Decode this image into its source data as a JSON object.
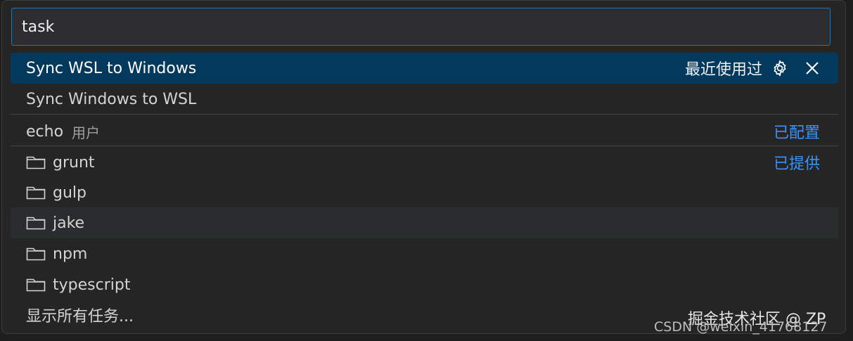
{
  "search": {
    "value": "task"
  },
  "items": [
    {
      "label": "Sync WSL to Windows",
      "recent_label": "最近使用过"
    },
    {
      "label": "Sync Windows to WSL"
    },
    {
      "label": "echo",
      "desc": "用户",
      "tag": "已配置"
    }
  ],
  "folders": [
    {
      "label": "grunt",
      "tag": "已提供"
    },
    {
      "label": "gulp"
    },
    {
      "label": "jake"
    },
    {
      "label": "npm"
    },
    {
      "label": "typescript"
    }
  ],
  "show_all": {
    "label": "显示所有任务..."
  },
  "watermark": {
    "line1": "掘金技术社区 @ ZP",
    "line2": "CSDN @weixin_41768127"
  },
  "colors": {
    "accent": "#0e79d1",
    "selected_bg": "#04395e",
    "tag": "#3794ff"
  },
  "icons": [
    "gear-icon",
    "close-icon",
    "folder-icon"
  ]
}
